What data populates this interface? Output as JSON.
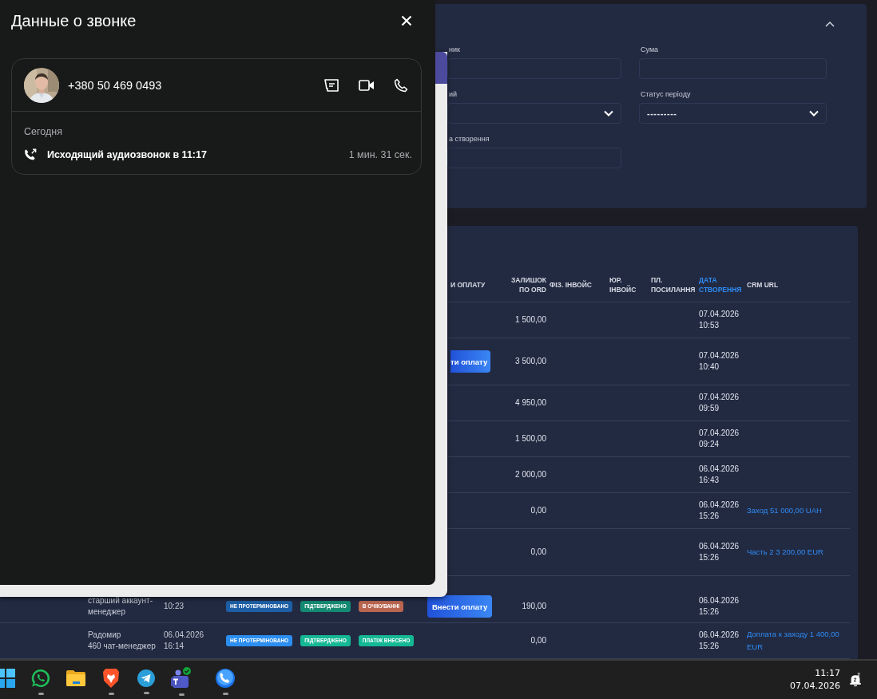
{
  "call_panel": {
    "title": "Данные о звонке",
    "contact": {
      "phone": "+380 50 469 0493"
    },
    "history": {
      "day": "Сегодня",
      "calls": [
        {
          "kind": "outgoing",
          "text": "Исходящий аудиозвонок в 11:17",
          "duration": "1 мин. 31 сек."
        }
      ]
    }
  },
  "filters": {
    "fields": [
      {
        "kind": "input",
        "label": "ник"
      },
      {
        "kind": "input",
        "label": "Сума"
      },
      {
        "kind": "select",
        "label": "ий"
      },
      {
        "kind": "select",
        "label": "Статус періоду",
        "value": "---------"
      },
      {
        "kind": "input",
        "label": "а створення"
      }
    ]
  },
  "table": {
    "columns": [
      {
        "label": "И ОПЛАТУ",
        "sorted": false
      },
      {
        "label": "ЗАЛИШОК ПО ORD",
        "sorted": false
      },
      {
        "label": "ФІЗ. ІНВОЙС",
        "sorted": false
      },
      {
        "label": "ЮР. ІНВОЙС",
        "sorted": false
      },
      {
        "label": "ПЛ. ПОСИЛАННЯ",
        "sorted": false
      },
      {
        "label": "ДАТА СТВОРЕННЯ",
        "sorted": true
      },
      {
        "label": "CRM URL",
        "sorted": false
      }
    ],
    "rows": [
      {
        "balance": "1 500,00",
        "created": "07.04.2026 10:53"
      },
      {
        "pay": {
          "kind": "partial",
          "label": "ти оплату"
        },
        "balance": "3 500,00",
        "created": "07.04.2026 10:40"
      },
      {
        "balance": "4 950,00",
        "created": "07.04.2026 09:59"
      },
      {
        "balance": "1 500,00",
        "created": "07.04.2026 09:24"
      },
      {
        "balance": "2 000,00",
        "created": "06.04.2026 16:43"
      },
      {
        "balance": "0,00",
        "created": "06.04.2026 15:26",
        "crm": "Заход 51 000,00 UAH"
      },
      {
        "balance": "0,00",
        "created": "06.04.2026 15:26",
        "crm": "Часть 2 3 200,00 EUR"
      },
      {
        "role": "старший аккаунт-менеджер",
        "date": "10:23",
        "badges": [
          {
            "text": "НЕ ПРОТЕРМІНОВАНО",
            "color": "#1d5fa6"
          },
          {
            "text": "ПІДТВЕРДЖЕНО",
            "color": "#148a72"
          },
          {
            "text": "В ОЧІКУВАННІ",
            "color": "#b9654f"
          }
        ],
        "pay": {
          "kind": "button",
          "label": "Внести оплату"
        },
        "balance": "190,00",
        "created": "06.04.2026 15:26"
      },
      {
        "name": "Радомир",
        "role": "460 чат-менеджер",
        "date": "06.04.2026 16:14",
        "badges": [
          {
            "text": "НЕ ПРОТЕРМІНОВАНО",
            "color": "#2b8ef0"
          },
          {
            "text": "ПІДТВЕРДЖЕНО",
            "color": "#15b894"
          },
          {
            "text": "ПЛАТІЖ ВНЕСЕНО",
            "color": "#15b894"
          }
        ],
        "balance": "0,00",
        "created": "06.04.2026 15:26",
        "crm": "Доплата к заходу 1 400,00 EUR"
      }
    ]
  },
  "taskbar": {
    "apps": [
      {
        "kind": "windows",
        "running": false
      },
      {
        "kind": "whatsapp",
        "running": true
      },
      {
        "kind": "folder",
        "running": false
      },
      {
        "kind": "brave",
        "running": true
      },
      {
        "kind": "telegram",
        "running": true
      },
      {
        "kind": "teams",
        "running": true
      },
      {
        "kind": "phone",
        "running": true
      }
    ],
    "time": "11:17",
    "date": "07.04.2026"
  }
}
